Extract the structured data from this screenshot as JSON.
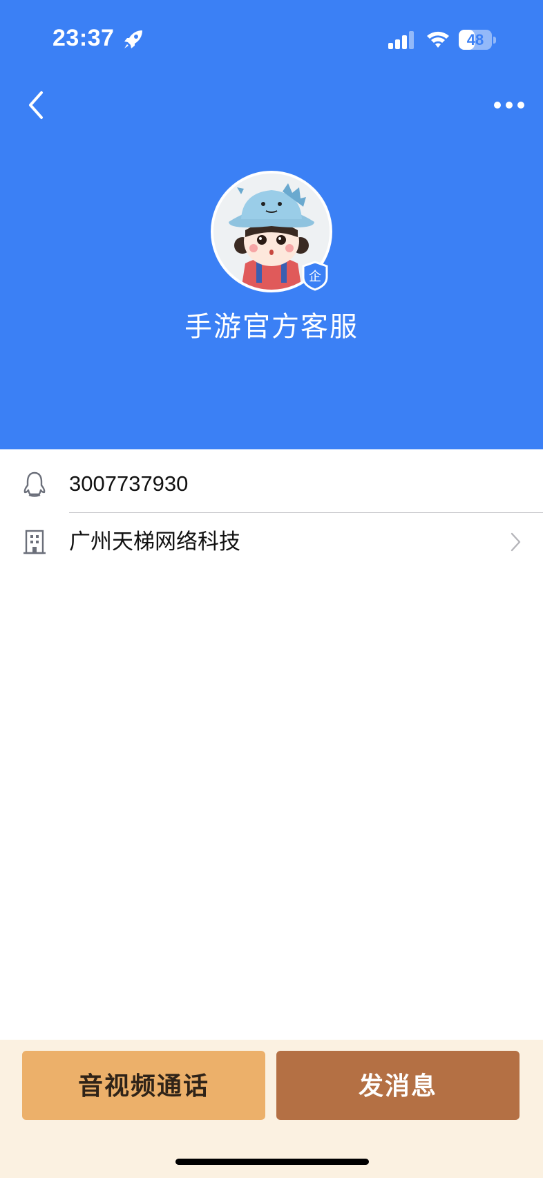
{
  "status_bar": {
    "time": "23:37",
    "battery": "48",
    "battery_level": 0.48,
    "icons": [
      "rocket-icon",
      "signal-icon",
      "wifi-icon",
      "battery-icon"
    ]
  },
  "nav": {
    "back_icon": "chevron-left-icon",
    "more_icon": "more-dots-icon"
  },
  "profile": {
    "name": "手游官方客服",
    "badge": "企"
  },
  "info": {
    "qq_number": "3007737930",
    "company": "广州天梯网络科技"
  },
  "actions": {
    "call_label": "音视频通话",
    "message_label": "发消息"
  },
  "colors": {
    "header_bg": "#3b80f5",
    "bottom_bg": "#fbf1e1",
    "call_btn": "#ecb06a",
    "message_btn": "#b47044"
  }
}
